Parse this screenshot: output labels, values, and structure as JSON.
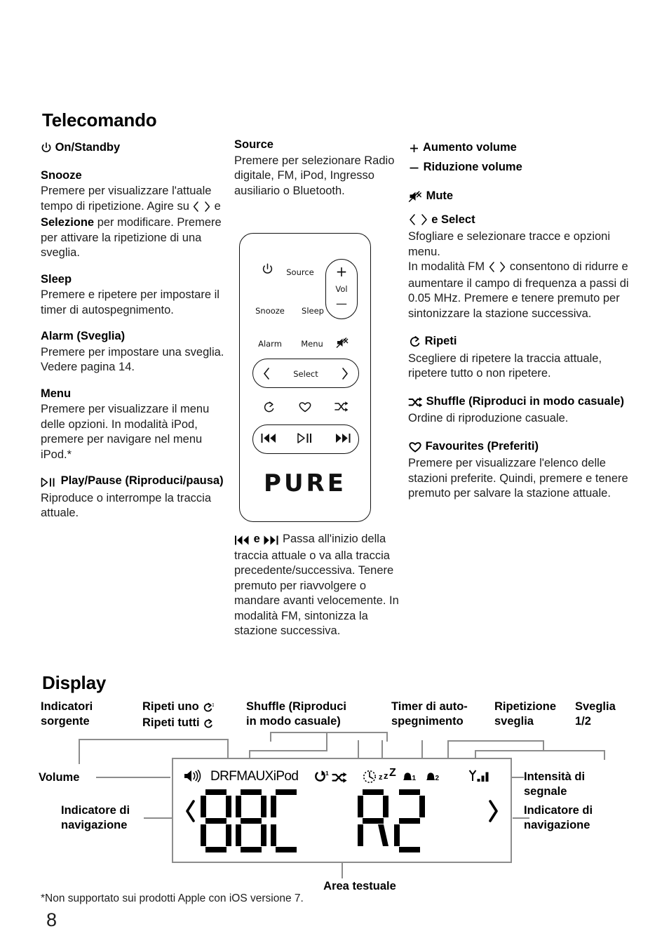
{
  "document": {
    "page_number": "8",
    "footnote": "*Non supportato sui prodotti Apple con iOS versione 7."
  },
  "sections": {
    "remote": {
      "title": "Telecomando"
    },
    "display": {
      "title": "Display"
    }
  },
  "remote_entries": {
    "left": [
      {
        "icon": "power-icon",
        "heading": "On/Standby",
        "body": ""
      },
      {
        "icon": null,
        "heading": "Snooze",
        "body": "Premere per visualizzare l'attuale tempo di ripetizione. Agire su ‹ › e Selezione per modificare. Premere per attivare la ripetizione di una sveglia."
      },
      {
        "icon": null,
        "heading": "Sleep",
        "body": "Premere e ripetere per impostare il timer di autospegnimento."
      },
      {
        "icon": null,
        "heading": "Alarm (Sveglia)",
        "body": "Premere per impostare una sveglia. Vedere pagina 14."
      },
      {
        "icon": null,
        "heading": "Menu",
        "body": "Premere per visualizzare il menu delle opzioni. In modalità iPod, premere per navigare nel menu iPod.*"
      },
      {
        "icon": "play-pause-icon",
        "heading": "Play/Pause (Riproduci/pausa)",
        "body": "Riproduce o interrompe la traccia attuale."
      }
    ],
    "middle": [
      {
        "heading": "Source",
        "body": "Premere per selezionare Radio digitale, FM, iPod, Ingresso ausiliario o Bluetooth."
      }
    ],
    "middle_below_image": {
      "icons": "prev-track-icon e next-track-icon",
      "body": "Passa all'inizio della traccia attuale o va alla traccia precedente/successiva. Tenere premuto per riavvolgere o mandare avanti velocemente. In modalità FM, sintonizza la stazione successiva."
    },
    "right": [
      {
        "icon": "plus-icon",
        "heading": "Aumento volume",
        "body": ""
      },
      {
        "icon": "minus-icon",
        "heading": "Riduzione volume",
        "body": ""
      },
      {
        "icon": "mute-icon",
        "heading": "Mute",
        "body": ""
      },
      {
        "icon": "left-right-chevrons-icon",
        "heading": "e Select",
        "body": "Sfogliare e selezionare tracce e opzioni menu. In modalità FM ‹ › consentono di ridurre e aumentare il campo di frequenza a passi di 0.05 MHz. Premere e tenere premuto per sintonizzare la stazione successiva."
      },
      {
        "icon": "repeat-icon",
        "heading": "Ripeti",
        "body": "Scegliere di ripetere la traccia attuale, ripetere tutto o non ripetere."
      },
      {
        "icon": "shuffle-icon",
        "heading": "Shuffle (Riproduci in modo casuale)",
        "body": "Ordine di riproduzione casuale."
      },
      {
        "icon": "heart-icon",
        "heading": "Favourites (Preferiti)",
        "body": "Premere per visualizzare l'elenco delle stazioni preferite. Quindi, premere e tenere premuto per salvare la stazione attuale."
      }
    ]
  },
  "remote_image": {
    "keys": {
      "power": "power-icon",
      "source": "Source",
      "vol_plus": "+",
      "vol_label": "Vol",
      "vol_minus": "—",
      "snooze": "Snooze",
      "sleep": "Sleep",
      "alarm": "Alarm",
      "menu": "Menu",
      "mute": "mute-icon",
      "select": "Select",
      "left_chevron": "‹",
      "right_chevron": "›",
      "repeat": "repeat-icon",
      "favourite": "heart-icon",
      "shuffle": "shuffle-icon",
      "prev": "prev-track-icon",
      "play_pause": "play-pause-icon",
      "next": "next-track-icon"
    },
    "brand": "PURE"
  },
  "display_diagram": {
    "labels": {
      "source_indicators": "Indicatori\nsorgente",
      "repeat": "Ripeti uno ↺¹\nRipeti tutti ↺",
      "shuffle": "Shuffle (Riproduci\nin modo casuale)",
      "sleep_timer": "Timer di auto-\nspegnimento",
      "snooze": "Ripetizione\nsveglia",
      "alarm": "Sveglia\n1/2",
      "volume": "Volume",
      "nav_left": "Indicatore di\nnavigazione",
      "signal": "Intensità di\nsegnale",
      "nav_right": "Indicatore di\nnavigazione",
      "text_area": "Area testuale"
    },
    "labels_flat": {
      "source_indicators_l1": "Indicatori",
      "source_indicators_l2": "sorgente",
      "repeat_l1": "Ripeti uno",
      "repeat_l2": "Ripeti tutti",
      "shuffle_l1": "Shuffle (Riproduci",
      "shuffle_l2": "in modo casuale)",
      "sleep_l1": "Timer di auto-",
      "sleep_l2": "spegnimento",
      "snooze_l1": "Ripetizione",
      "snooze_l2": "sveglia",
      "alarm_l1": "Sveglia",
      "alarm_l2": "1/2",
      "volume": "Volume",
      "nav_left_l1": "Indicatore di",
      "nav_left_l2": "navigazione",
      "signal_l1": "Intensità di",
      "signal_l2": "segnale",
      "nav_right_l1": "Indicatore di",
      "nav_right_l2": "navigazione",
      "text_area": "Area testuale"
    },
    "lcd": {
      "source_list": "DRFMAUXiPod",
      "text_left": "BBC",
      "text_right": "R2",
      "repeat_badge": "1",
      "alarm1_badge": "1",
      "alarm2_badge": "2",
      "sleep_z": "ZZ",
      "icons": [
        "speaker-icon",
        "repeat-one-icon",
        "shuffle-icon",
        "clock-sleep-icon",
        "bell-1-icon",
        "bell-2-icon",
        "signal-strength-icon",
        "nav-left-icon",
        "nav-right-icon"
      ]
    }
  },
  "colors": {
    "text": "#1d1d1d",
    "heading": "#000000",
    "rule": "#8c8c8c",
    "lcd_border": "#8c8c8c"
  }
}
